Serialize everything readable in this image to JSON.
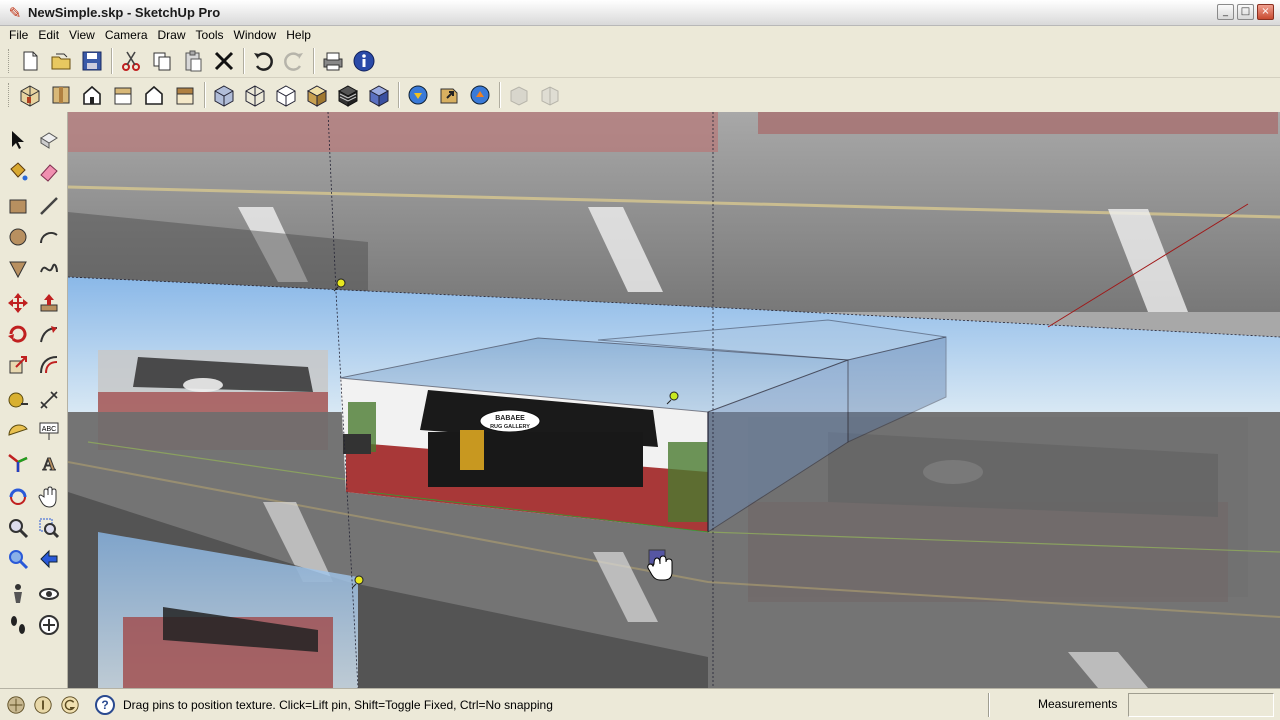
{
  "window": {
    "title": "NewSimple.skp - SketchUp Pro",
    "minimize": "_",
    "maximize": "□",
    "close": "×"
  },
  "menu": [
    "File",
    "Edit",
    "View",
    "Camera",
    "Draw",
    "Tools",
    "Window",
    "Help"
  ],
  "toolbar_standard": [
    {
      "name": "new-icon"
    },
    {
      "name": "open-icon"
    },
    {
      "name": "save-icon"
    },
    {
      "name": "cut-icon"
    },
    {
      "name": "copy-icon"
    },
    {
      "name": "paste-icon"
    },
    {
      "name": "erase-icon"
    },
    {
      "name": "undo-icon"
    },
    {
      "name": "redo-icon"
    },
    {
      "name": "print-icon"
    },
    {
      "name": "model-info-icon"
    }
  ],
  "toolbar_views": [
    {
      "name": "iso-view-icon"
    },
    {
      "name": "top-view-icon"
    },
    {
      "name": "front-view-icon"
    },
    {
      "name": "right-view-icon"
    },
    {
      "name": "back-view-icon"
    },
    {
      "name": "left-view-icon"
    },
    {
      "name": "xray-style-icon"
    },
    {
      "name": "wireframe-style-icon"
    },
    {
      "name": "hidden-line-style-icon"
    },
    {
      "name": "shaded-style-icon"
    },
    {
      "name": "shaded-texture-style-icon"
    },
    {
      "name": "monochrome-style-icon"
    },
    {
      "name": "get-models-icon"
    },
    {
      "name": "share-model-icon"
    },
    {
      "name": "share-component-icon"
    },
    {
      "name": "get-photo-texture-icon"
    },
    {
      "name": "photo-texture-icon"
    }
  ],
  "palette": [
    [
      "select-icon",
      "make-component-icon"
    ],
    [
      "paint-bucket-icon",
      "eraser-icon"
    ],
    [
      "rectangle-icon",
      "line-icon"
    ],
    [
      "circle-icon",
      "arc-icon"
    ],
    [
      "polygon-icon",
      "freehand-icon"
    ],
    [
      "move-icon",
      "push-pull-icon"
    ],
    [
      "rotate-icon",
      "follow-me-icon"
    ],
    [
      "scale-icon",
      "offset-icon"
    ],
    [
      "tape-measure-icon",
      "dimension-icon"
    ],
    [
      "protractor-icon",
      "text-icon"
    ],
    [
      "axes-icon",
      "3d-text-icon"
    ],
    [
      "orbit-icon",
      "pan-icon"
    ],
    [
      "zoom-icon",
      "zoom-window-icon"
    ],
    [
      "zoom-extents-icon",
      "previous-view-icon"
    ],
    [
      "position-camera-icon",
      "look-around-icon"
    ],
    [
      "walk-icon",
      "section-plane-icon"
    ]
  ],
  "status": {
    "message": "Drag pins to position texture.  Click=Lift pin, Shift=Toggle Fixed, Ctrl=No snapping",
    "measurements_label": "Measurements",
    "measurements_value": ""
  },
  "storefront_sign": {
    "line1": "BABAEE",
    "line2": "RUG GALLERY"
  }
}
